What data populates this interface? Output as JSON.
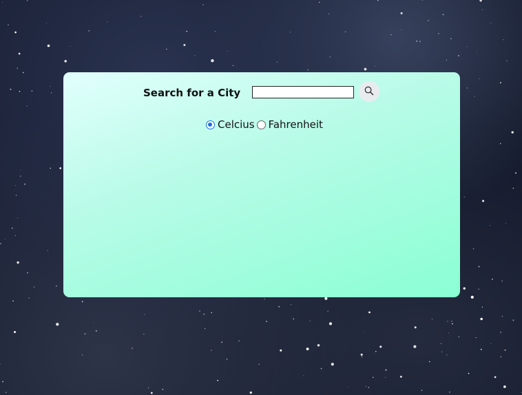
{
  "search": {
    "label": "Search for a City",
    "input_value": "",
    "placeholder": "",
    "button_icon": "search-icon"
  },
  "units": {
    "options": [
      {
        "label": "Celcius",
        "selected": true
      },
      {
        "label": "Fahrenheit",
        "selected": false
      }
    ]
  },
  "colors": {
    "card_gradient_start": "#e2fffd",
    "card_gradient_end": "#8affd4",
    "radio_accent": "#1a6fe0",
    "background": "#141a2c"
  }
}
